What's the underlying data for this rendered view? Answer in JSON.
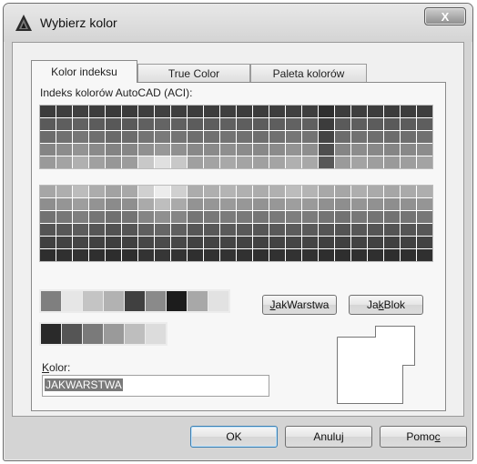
{
  "window": {
    "title": "Wybierz kolor",
    "close_glyph": "X"
  },
  "tabs": [
    {
      "label": "Kolor indeksu",
      "active": true
    },
    {
      "label": "True Color",
      "active": false
    },
    {
      "label": "Paleta kolorów",
      "active": false
    }
  ],
  "aci": {
    "label": "Indeks kolorów AutoCAD (ACI):",
    "top_grid_colors": [
      [
        "#3c3c3c",
        "#3e3e3e",
        "#404040",
        "#3d3d3d",
        "#3a3a3a",
        "#3b3b3b",
        "#3e3e3e",
        "#404040",
        "#3e3e3e",
        "#3c3c3c",
        "#3d3d3d",
        "#3f3f3f",
        "#3d3d3d",
        "#3c3c3c",
        "#3e3e3e",
        "#404040",
        "#3e3e3e",
        "#2e2e2e",
        "#3c3c3c",
        "#3e3e3e",
        "#3d3d3d",
        "#3c3c3c",
        "#3d3d3d",
        "#3e3e3e"
      ],
      [
        "#5a5a5a",
        "#5e5e5e",
        "#626262",
        "#5c5c5c",
        "#585858",
        "#5a5a5a",
        "#606060",
        "#646464",
        "#606060",
        "#5c5c5c",
        "#5d5d5d",
        "#606060",
        "#5e5e5e",
        "#5c5c5c",
        "#5e5e5e",
        "#626262",
        "#606060",
        "#3c3c3c",
        "#5a5a5a",
        "#5e5e5e",
        "#5c5c5c",
        "#5a5a5a",
        "#5c5c5c",
        "#5e5e5e"
      ],
      [
        "#6c6c6c",
        "#717171",
        "#767676",
        "#6f6f6f",
        "#6a6a6a",
        "#6c6c6c",
        "#747474",
        "#7a7a7a",
        "#747474",
        "#6e6e6e",
        "#707070",
        "#737373",
        "#717171",
        "#6e6e6e",
        "#707070",
        "#767676",
        "#737373",
        "#444444",
        "#6c6c6c",
        "#717171",
        "#6e6e6e",
        "#6c6c6c",
        "#6e6e6e",
        "#717171"
      ],
      [
        "#858585",
        "#8c8c8c",
        "#939393",
        "#8a8a8a",
        "#838383",
        "#868686",
        "#909090",
        "#989898",
        "#909090",
        "#888888",
        "#8a8a8a",
        "#8e8e8e",
        "#8b8b8b",
        "#888888",
        "#8b8b8b",
        "#939393",
        "#8e8e8e",
        "#4e4e4e",
        "#858585",
        "#8c8c8c",
        "#888888",
        "#858585",
        "#888888",
        "#8c8c8c"
      ],
      [
        "#9a9a9a",
        "#a3a3a3",
        "#b0b0b0",
        "#a0a0a0",
        "#979797",
        "#9c9c9c",
        "#c8c8c8",
        "#e0e0e0",
        "#c8c8c8",
        "#a0a0a0",
        "#a3a3a3",
        "#a8a8a8",
        "#a4a4a4",
        "#a0a0a0",
        "#a4a4a4",
        "#b0b0b0",
        "#a8a8a8",
        "#585858",
        "#9a9a9a",
        "#a3a3a3",
        "#9e9e9e",
        "#9a9a9a",
        "#9e9e9e",
        "#a3a3a3"
      ]
    ],
    "bottom_grid_colors": [
      [
        "#a6a6a6",
        "#aeaeae",
        "#bcbcbc",
        "#acacac",
        "#a2a2a2",
        "#a8a8a8",
        "#d0d0d0",
        "#ececec",
        "#d0d0d0",
        "#acacac",
        "#afafaf",
        "#b4b4b4",
        "#b0b0b0",
        "#acacac",
        "#b0b0b0",
        "#bcbcbc",
        "#b4b4b4",
        "#a8a8a8",
        "#a6a6a6",
        "#aeaeae",
        "#aaaaaa",
        "#a6a6a6",
        "#aaaaaa",
        "#aeaeae"
      ],
      [
        "#8e8e8e",
        "#959595",
        "#9e9e9e",
        "#939393",
        "#8b8b8b",
        "#8f8f8f",
        "#aaaaaa",
        "#bebebe",
        "#aaaaaa",
        "#939393",
        "#969696",
        "#9a9a9a",
        "#979797",
        "#939393",
        "#979797",
        "#9e9e9e",
        "#9a9a9a",
        "#909090",
        "#8e8e8e",
        "#959595",
        "#919191",
        "#8e8e8e",
        "#919191",
        "#959595"
      ],
      [
        "#727272",
        "#777777",
        "#7e7e7e",
        "#757575",
        "#707070",
        "#737373",
        "#858585",
        "#909090",
        "#858585",
        "#757575",
        "#787878",
        "#7b7b7b",
        "#797979",
        "#757575",
        "#797979",
        "#7e7e7e",
        "#7b7b7b",
        "#747474",
        "#727272",
        "#777777",
        "#747474",
        "#727272",
        "#747474",
        "#777777"
      ],
      [
        "#545454",
        "#575757",
        "#5c5c5c",
        "#565656",
        "#525252",
        "#555555",
        "#5f5f5f",
        "#666666",
        "#5f5f5f",
        "#565656",
        "#585858",
        "#5a5a5a",
        "#595959",
        "#565656",
        "#595959",
        "#5c5c5c",
        "#5a5a5a",
        "#555555",
        "#545454",
        "#575757",
        "#555555",
        "#545454",
        "#555555",
        "#575757"
      ],
      [
        "#404040",
        "#424242",
        "#454545",
        "#414141",
        "#3e3e3e",
        "#404040",
        "#474747",
        "#4b4b4b",
        "#474747",
        "#414141",
        "#434343",
        "#444444",
        "#434343",
        "#414141",
        "#434343",
        "#454545",
        "#444444",
        "#404040",
        "#404040",
        "#424242",
        "#414141",
        "#404040",
        "#414141",
        "#424242"
      ],
      [
        "#2e2e2e",
        "#303030",
        "#323232",
        "#2f2f2f",
        "#2d2d2d",
        "#2e2e2e",
        "#333333",
        "#363636",
        "#333333",
        "#2f2f2f",
        "#313131",
        "#323232",
        "#313131",
        "#2f2f2f",
        "#313131",
        "#323232",
        "#323232",
        "#2e2e2e",
        "#2e2e2e",
        "#303030",
        "#2f2f2f",
        "#2e2e2e",
        "#2f2f2f",
        "#303030"
      ]
    ]
  },
  "standard_colors": [
    "#7f7f7f",
    "#e6e6e6",
    "#c4c4c4",
    "#b2b2b2",
    "#404040",
    "#8a8a8a",
    "#1c1c1c",
    "#a8a8a8",
    "#e2e2e2"
  ],
  "gray_colors": [
    "#2a2a2a",
    "#555555",
    "#7a7a7a",
    "#9a9a9a",
    "#bebebe",
    "#dcdcdc"
  ],
  "buttons": {
    "bylayer_pre": "",
    "bylayer_key": "J",
    "bylayer_post": "akWarstwa",
    "byblock_pre": "Ja",
    "byblock_key": "k",
    "byblock_post": "Blok"
  },
  "color_field": {
    "label_key": "K",
    "label_rest": "olor:",
    "value": "JAKWARSTWA"
  },
  "footer": {
    "ok": "OK",
    "cancel": "Anuluj",
    "help_pre": "Pomo",
    "help_key": "c"
  }
}
